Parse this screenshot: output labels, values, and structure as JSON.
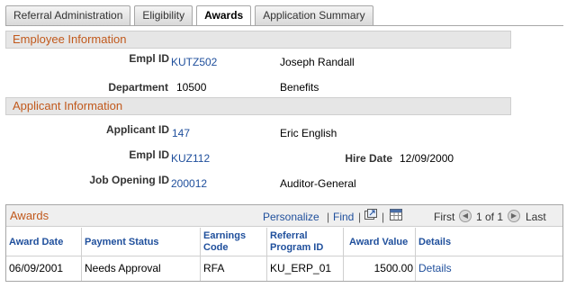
{
  "tabs": [
    {
      "label": "Referral Administration"
    },
    {
      "label": "Eligibility"
    },
    {
      "label": "Awards"
    },
    {
      "label": "Application Summary"
    }
  ],
  "employee_section": {
    "title": "Employee Information",
    "empl_id_label": "Empl ID",
    "empl_id_value": "KUTZ502",
    "employee_name": "Joseph Randall",
    "department_label": "Department",
    "department_code": "10500",
    "department_name": "Benefits"
  },
  "applicant_section": {
    "title": "Applicant Information",
    "applicant_id_label": "Applicant ID",
    "applicant_id_value": "147",
    "applicant_name": "Eric English",
    "empl_id_label": "Empl ID",
    "empl_id_value": "KUZ112",
    "hire_date_label": "Hire Date",
    "hire_date_value": "12/09/2000",
    "job_opening_label": "Job Opening ID",
    "job_opening_value": "200012",
    "job_title": "Auditor-General"
  },
  "awards_grid": {
    "title": "Awards",
    "personalize": "Personalize",
    "find": "Find",
    "first": "First",
    "range": "1 of 1",
    "last": "Last",
    "columns": [
      "Award Date",
      "Payment Status",
      "Earnings Code",
      "Referral Program ID",
      "Award Value",
      "Details"
    ],
    "rows": [
      {
        "award_date": "06/09/2001",
        "payment_status": "Needs Approval",
        "earnings_code": "RFA",
        "program_id": "KU_ERP_01",
        "award_value": "1500.00",
        "details": "Details"
      }
    ]
  }
}
